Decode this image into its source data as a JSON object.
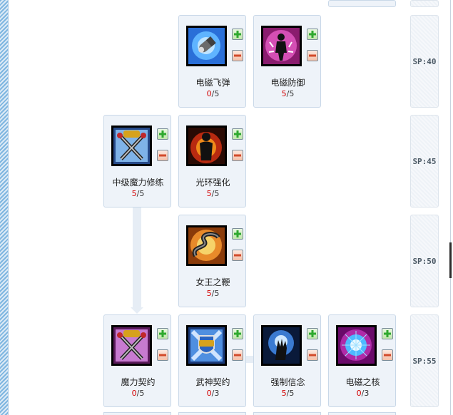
{
  "sp_rows": [
    {
      "label": "SP:40"
    },
    {
      "label": "SP:45"
    },
    {
      "label": "SP:50"
    },
    {
      "label": "SP:55"
    }
  ],
  "skills": {
    "missile": {
      "name": "电磁飞弹",
      "current": "0",
      "max": "/5"
    },
    "defense": {
      "name": "电磁防御",
      "current": "5",
      "max": "/5"
    },
    "magic_training": {
      "name": "中级魔力修练",
      "current": "5",
      "max": "/5"
    },
    "aura": {
      "name": "光环强化",
      "current": "5",
      "max": "/5"
    },
    "whip": {
      "name": "女王之鞭",
      "current": "5",
      "max": "/5"
    },
    "magic_contract": {
      "name": "魔力契约",
      "current": "0",
      "max": "/5"
    },
    "war_god": {
      "name": "武神契约",
      "current": "0",
      "max": "/3"
    },
    "belief": {
      "name": "强制信念",
      "current": "5",
      "max": "/5"
    },
    "core": {
      "name": "电磁之核",
      "current": "0",
      "max": "/3"
    }
  },
  "colors": {
    "level_current": "#d40000",
    "card_bg": "#eef3f9",
    "plus": "#2ea82e",
    "minus": "#d24a2a"
  }
}
